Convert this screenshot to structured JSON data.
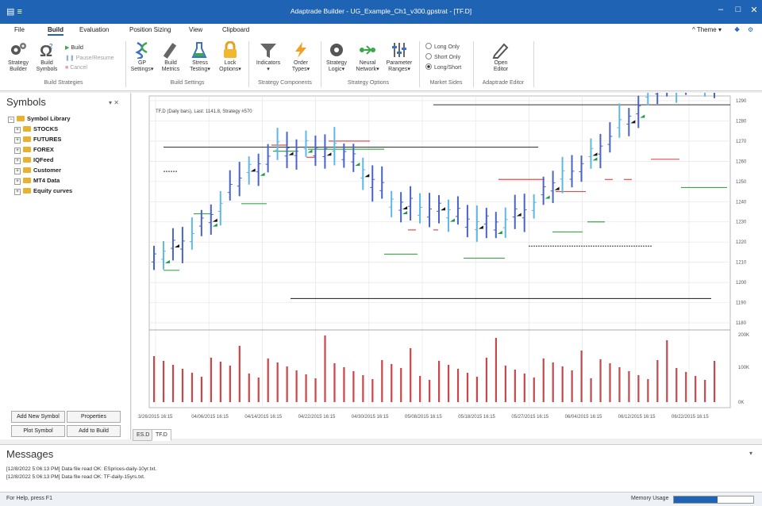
{
  "window": {
    "title": "Adaptrade Builder - UG_Example_Ch1_v300.gpstrat - [TF.D]"
  },
  "menu": {
    "items": [
      "File",
      "Build",
      "Evaluation",
      "Position Sizing",
      "View",
      "Clipboard"
    ],
    "active": "Build",
    "theme_label": "Theme"
  },
  "ribbon": {
    "build_strategies": {
      "strategy_builder": "Strategy\nBuilder",
      "build_symbols": "Build\nSymbols",
      "build": "Build",
      "pause_resume": "Pause/Resume",
      "cancel": "Cancel",
      "group": "Build Strategies"
    },
    "build_settings": {
      "gp_settings": "GP\nSettings",
      "build_metrics": "Build\nMetrics",
      "stress_testing": "Stress\nTesting",
      "lock_options": "Lock\nOptions",
      "group": "Build Settings"
    },
    "strategy_components": {
      "indicators": "Indicators",
      "order_types": "Order\nTypes",
      "group": "Strategy Components"
    },
    "strategy_options": {
      "strategy_logic": "Strategy\nLogic",
      "neural_network": "Neural\nNetwork",
      "parameter_ranges": "Parameter\nRanges",
      "group": "Strategy Options"
    },
    "market_sides": {
      "options": [
        "Long Only",
        "Short Only",
        "Long/Short"
      ],
      "selected": "Long/Short",
      "group": "Market Sides"
    },
    "editor": {
      "open_editor": "Open\nEditor",
      "group": "Adaptrade Editor"
    }
  },
  "symbols": {
    "title": "Symbols",
    "tree": {
      "root": "Symbol Library",
      "children": [
        "STOCKS",
        "FUTURES",
        "FOREX",
        "IQFeed",
        "Customer",
        "MT4 Data",
        "Equity curves"
      ]
    },
    "buttons": {
      "add_new_symbol": "Add New Symbol",
      "properties": "Properties",
      "plot_symbol": "Plot Symbol",
      "add_to_build": "Add to Build"
    }
  },
  "chart": {
    "info_label": "TF.D (Daily bars), Last: 1141.8, Strategy #570",
    "price_axis": [
      "1290",
      "1280",
      "1270",
      "1260",
      "1250",
      "1240",
      "1230",
      "1220",
      "1210",
      "1200",
      "1190",
      "1180"
    ],
    "volume_axis": [
      "200K",
      "100K",
      "0K"
    ],
    "date_axis": [
      "3/26/2015 16:15",
      "04/06/2015 16:15",
      "04/14/2015 16:15",
      "04/22/2015 16:15",
      "04/30/2015 16:15",
      "05/08/2015 16:15",
      "05/18/2015 16:15",
      "05/27/2015 16:15",
      "06/04/2015 16:15",
      "06/12/2015 16:15",
      "06/22/2015 16:15"
    ],
    "colors": {
      "up_bar": "#4a63c8",
      "down_bar": "#5db8e8",
      "volume": "#c8474b",
      "long_target": "#3aa84a",
      "short_target": "#e84a4a",
      "grid": "#e6e6e6"
    }
  },
  "tabs": [
    "ES.D",
    "TF.D"
  ],
  "active_tab": "TF.D",
  "messages": {
    "title": "Messages",
    "lines": [
      "[12/8/2022 5:06:13 PM]  Data file read OK: ESprices-daily-10yr.txt.",
      "[12/8/2022 5:06:13 PM]  Data file read OK: TF-daily-15yrs.txt."
    ]
  },
  "status": {
    "help": "For Help, press F1",
    "memory_label": "Memory Usage",
    "memory_fraction": 0.55
  }
}
